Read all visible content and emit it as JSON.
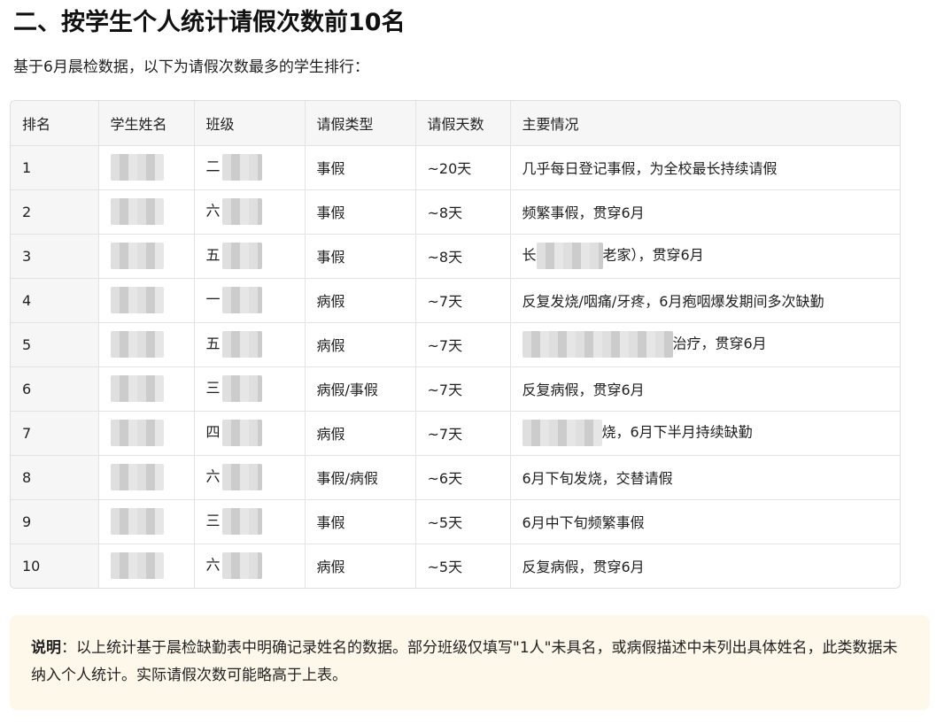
{
  "page": {
    "title": "二、按学生个人统计请假次数前10名",
    "intro": "基于6月晨检数据，以下为请假次数最多的学生排行："
  },
  "table": {
    "headers": [
      "排名",
      "学生姓名",
      "班级",
      "请假类型",
      "请假天数",
      "主要情况"
    ],
    "rows": [
      {
        "rank": "1",
        "class_prefix": "二",
        "type": "事假",
        "days": "~20天",
        "desc_prefix": "",
        "desc": "几乎每日登记事假，为全校最长持续请假"
      },
      {
        "rank": "2",
        "class_prefix": "六",
        "type": "事假",
        "days": "~8天",
        "desc_prefix": "",
        "desc": "频繁事假，贯穿6月"
      },
      {
        "rank": "3",
        "class_prefix": "五",
        "type": "事假",
        "days": "~8天",
        "desc_prefix": "长",
        "desc": "老家），贯穿6月"
      },
      {
        "rank": "4",
        "class_prefix": "一",
        "type": "病假",
        "days": "~7天",
        "desc_prefix": "",
        "desc": "反复发烧/咽痛/牙疼，6月疱咽爆发期间多次缺勤"
      },
      {
        "rank": "5",
        "class_prefix": "五",
        "type": "病假",
        "days": "~7天",
        "desc_prefix": "",
        "desc": "治疗，贯穿6月"
      },
      {
        "rank": "6",
        "class_prefix": "三",
        "type": "病假/事假",
        "days": "~7天",
        "desc_prefix": "",
        "desc": "反复病假，贯穿6月"
      },
      {
        "rank": "7",
        "class_prefix": "四",
        "type": "病假",
        "days": "~7天",
        "desc_prefix": "",
        "desc": "烧，6月下半月持续缺勤"
      },
      {
        "rank": "8",
        "class_prefix": "六",
        "type": "事假/病假",
        "days": "~6天",
        "desc_prefix": "",
        "desc": "6月下旬发烧，交替请假"
      },
      {
        "rank": "9",
        "class_prefix": "三",
        "type": "事假",
        "days": "~5天",
        "desc_prefix": "",
        "desc": "6月中下旬频繁事假"
      },
      {
        "rank": "10",
        "class_prefix": "六",
        "type": "病假",
        "days": "~5天",
        "desc_prefix": "",
        "desc": "反复病假，贯穿6月"
      }
    ]
  },
  "note": {
    "label": "说明",
    "text": "：以上统计基于晨检缺勤表中明确记录姓名的数据。部分班级仅填写\"1人\"未具名，或病假描述中未列出具体姓名，此类数据未纳入个人统计。实际请假次数可能略高于上表。"
  }
}
